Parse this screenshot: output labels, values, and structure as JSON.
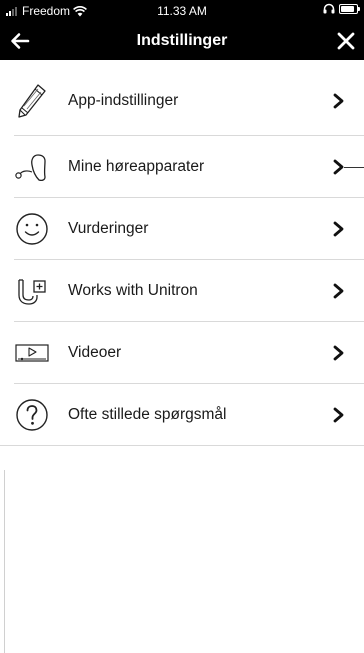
{
  "status_bar": {
    "carrier": "Freedom",
    "time": "11.33 AM",
    "battery_level": 0.85
  },
  "nav": {
    "title": "Indstillinger",
    "back_icon": "back-arrow-icon",
    "close_icon": "close-icon"
  },
  "menu": {
    "items": [
      {
        "label": "App-indstillinger",
        "icon": "pencil-icon"
      },
      {
        "label": "Mine høreapparater",
        "icon": "hearing-aid-icon"
      },
      {
        "label": "Vurderinger",
        "icon": "smiley-icon"
      },
      {
        "label": "Works with Unitron",
        "icon": "unitron-logo-icon"
      },
      {
        "label": "Videoer",
        "icon": "video-player-icon"
      },
      {
        "label": "Ofte stillede spørgsmål",
        "icon": "question-mark-icon"
      }
    ]
  },
  "colors": {
    "bar_background": "#000000",
    "bar_text": "#ffffff",
    "divider": "#d9d9d9",
    "text": "#1a1a1a"
  }
}
